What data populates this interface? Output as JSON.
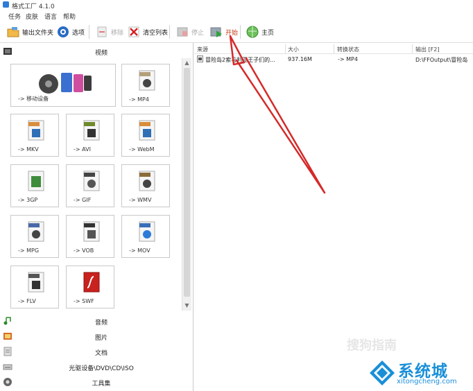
{
  "app": {
    "title": "格式工厂 4.1.0"
  },
  "menu": [
    "任务",
    "皮肤",
    "语言",
    "帮助"
  ],
  "toolbar": {
    "output_folder": "输出文件夹",
    "options": "选项",
    "remove": "移除",
    "clear_list": "清空列表",
    "stop": "停止",
    "start": "开始",
    "home": "主页"
  },
  "left": {
    "video_header": "视频",
    "video_tiles": [
      {
        "label": "-> 移动设备",
        "badge": ""
      },
      {
        "label": "-> MP4",
        "badge": "MP4"
      },
      {
        "label": "-> MKV",
        "badge": "MKV"
      },
      {
        "label": "-> AVI",
        "badge": "AVI"
      },
      {
        "label": "-> WebM",
        "badge": "WebM"
      },
      {
        "label": "-> 3GP",
        "badge": "3GP"
      },
      {
        "label": "-> GIF",
        "badge": "GIF"
      },
      {
        "label": "-> WMV",
        "badge": "WMV"
      },
      {
        "label": "-> MPG",
        "badge": "MPEG"
      },
      {
        "label": "-> VOB",
        "badge": "VOB"
      },
      {
        "label": "-> MOV",
        "badge": "MOV"
      },
      {
        "label": "-> FLV",
        "badge": "FLV"
      },
      {
        "label": "-> SWF",
        "badge": "SWF"
      }
    ],
    "categories": [
      "音频",
      "图片",
      "文档",
      "光驱设备\\DVD\\CD\\ISO",
      "工具集"
    ]
  },
  "table": {
    "headers": [
      "来源",
      "大小",
      "转换状态",
      "输出 [F2]"
    ],
    "rows": [
      [
        "冒险岛2索马利亚王子们的...",
        "937.16M",
        "-> MP4",
        "D:\\FFOutput\\冒险岛"
      ]
    ]
  },
  "watermark": {
    "faint": "搜狗指南",
    "brand": "系统城",
    "site": "xitongcheng.com"
  },
  "colors": {
    "accent": "#2d7bd8",
    "arrow": "#d42a2a",
    "brand": "#1a8fd8"
  }
}
